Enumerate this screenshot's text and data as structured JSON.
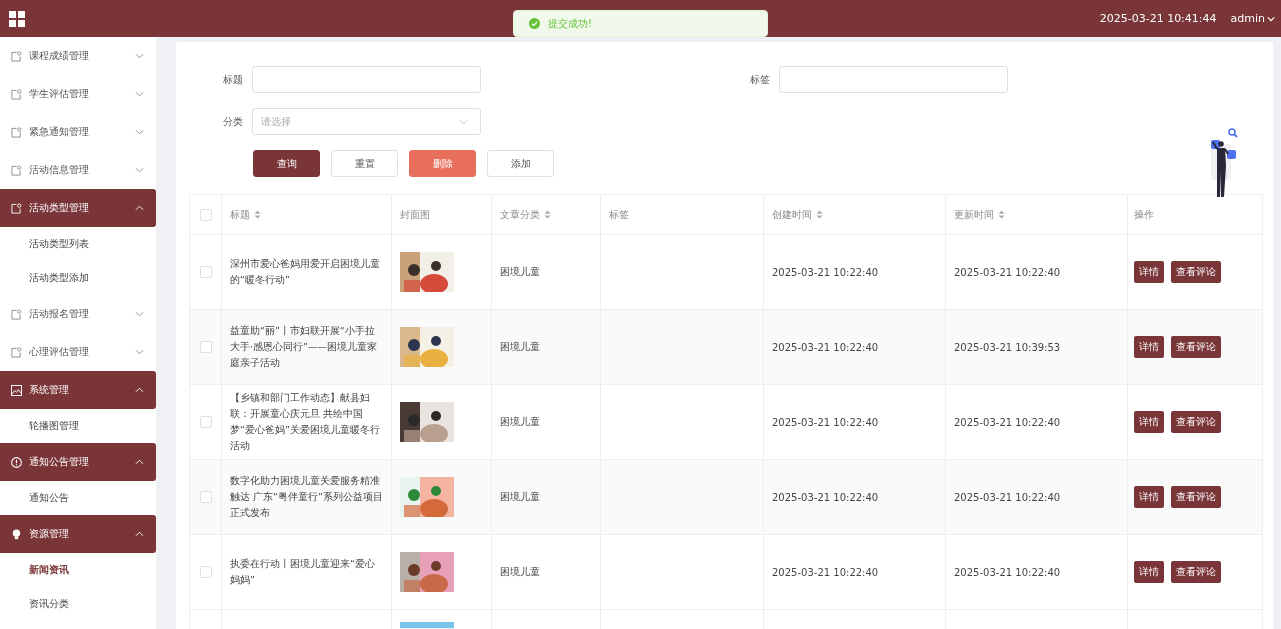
{
  "header": {
    "datetime": "2025-03-21 10:41:44",
    "user": "admin"
  },
  "toast": {
    "message": "提交成功!"
  },
  "sidebar": {
    "items": [
      {
        "label": "课程成绩管理",
        "expanded": false
      },
      {
        "label": "学生评估管理",
        "expanded": false
      },
      {
        "label": "紧急通知管理",
        "expanded": false
      },
      {
        "label": "活动信息管理",
        "expanded": false
      },
      {
        "label": "活动类型管理",
        "expanded": true,
        "children": [
          {
            "label": "活动类型列表",
            "selected": false
          },
          {
            "label": "活动类型添加",
            "selected": false
          }
        ]
      },
      {
        "label": "活动报名管理",
        "expanded": false
      },
      {
        "label": "心理评估管理",
        "expanded": false
      },
      {
        "label": "系统管理",
        "expanded": true,
        "children": [
          {
            "label": "轮播图管理",
            "selected": false
          }
        ]
      },
      {
        "label": "通知公告管理",
        "expanded": true,
        "children": [
          {
            "label": "通知公告",
            "selected": false
          }
        ]
      },
      {
        "label": "资源管理",
        "expanded": true,
        "children": [
          {
            "label": "新闻资讯",
            "selected": true
          },
          {
            "label": "资讯分类",
            "selected": false
          }
        ]
      }
    ]
  },
  "search": {
    "title_label": "标题",
    "tag_label": "标签",
    "category_label": "分类",
    "category_placeholder": "请选择",
    "buttons": [
      {
        "label": "查询",
        "kind": "primary"
      },
      {
        "label": "重置",
        "kind": "plain"
      },
      {
        "label": "删除",
        "kind": "danger"
      },
      {
        "label": "添加",
        "kind": "plain"
      }
    ]
  },
  "table": {
    "all_checked": false,
    "columns": [
      {
        "label": "标题",
        "sortable": true
      },
      {
        "label": "封面图",
        "sortable": false
      },
      {
        "label": "文章分类",
        "sortable": true
      },
      {
        "label": "标签",
        "sortable": false
      },
      {
        "label": "创建时间",
        "sortable": true
      },
      {
        "label": "更新时间",
        "sortable": true
      },
      {
        "label": "操作",
        "sortable": false
      }
    ],
    "rows": [
      {
        "title": "深州市爱心爸妈用爱开启困境儿童的“暖冬行动”",
        "category": "困境儿童",
        "created": "2025-03-21 10:22:40",
        "updated": "2025-03-21 10:22:40",
        "checked": false,
        "actions": [
          "详情",
          "查看评论"
        ]
      },
      {
        "title": "益童助“丽”丨市妇联开展“小手拉大手·感恩心同行”——困境儿童家庭亲子活动",
        "category": "困境儿童",
        "created": "2025-03-21 10:22:40",
        "updated": "2025-03-21 10:39:53",
        "checked": false,
        "actions": [
          "详情",
          "查看评论"
        ]
      },
      {
        "title": "【乡镇和部门工作动态】献县妇联：开展童心庆元旦 共绘中国梦“爱心爸妈”关爱困境儿童暖冬行活动",
        "category": "困境儿童",
        "created": "2025-03-21 10:22:40",
        "updated": "2025-03-21 10:22:40",
        "checked": false,
        "actions": [
          "详情",
          "查看评论"
        ]
      },
      {
        "title": "数字化助力困境儿童关爱服务精准触达 广东“粤伴童行”系列公益项目正式发布",
        "category": "困境儿童",
        "created": "2025-03-21 10:22:40",
        "updated": "2025-03-21 10:22:40",
        "checked": false,
        "actions": [
          "详情",
          "查看评论"
        ]
      },
      {
        "title": "执委在行动丨困境儿童迎来“爱心妈妈”",
        "category": "困境儿童",
        "created": "2025-03-21 10:22:40",
        "updated": "2025-03-21 10:22:40",
        "checked": false,
        "actions": [
          "详情",
          "查看评论"
        ]
      }
    ]
  }
}
